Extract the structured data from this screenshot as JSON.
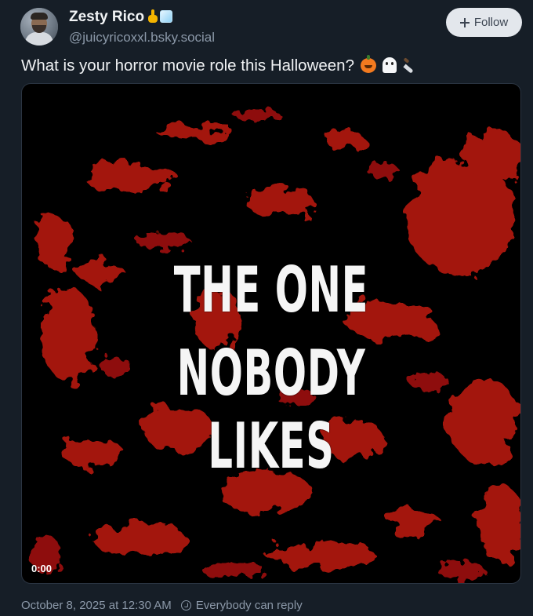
{
  "post": {
    "author": {
      "display_name": "Zesty Rico",
      "handle": "@juicyricoxxl.bsky.social",
      "badges": [
        "pointing-finger-icon",
        "ice-cube-icon"
      ]
    },
    "follow_label": "Follow",
    "text": "What is your horror movie role this Halloween?",
    "emojis": [
      "pumpkin-icon",
      "ghost-icon",
      "knife-icon"
    ],
    "video": {
      "title_line1": "THE ONE",
      "title_line2": "NOBODY LIKES",
      "time": "0:00"
    },
    "timestamp": "October 8, 2025 at 12:30 AM",
    "reply_setting": "Everybody can reply"
  },
  "colors": {
    "background": "#161e27",
    "text_primary": "#f1f3f5",
    "text_secondary": "#8b98a8",
    "follow_button_bg": "#e3e7ec",
    "blood_red": "#b3150f"
  }
}
